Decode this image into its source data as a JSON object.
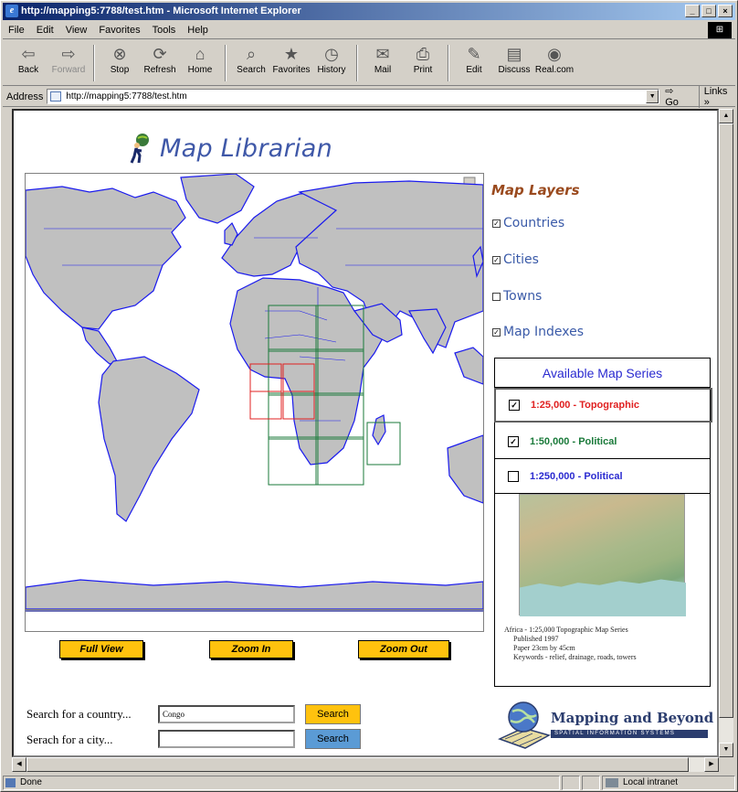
{
  "window": {
    "title": "http://mapping5:7788/test.htm - Microsoft Internet Explorer",
    "controls": [
      "_",
      "□",
      "×"
    ]
  },
  "menu": [
    "File",
    "Edit",
    "View",
    "Favorites",
    "Tools",
    "Help"
  ],
  "toolbar": [
    {
      "label": "Back",
      "icon": "back-icon",
      "glyph": "⇦",
      "disabled": false
    },
    {
      "label": "Forward",
      "icon": "forward-icon",
      "glyph": "⇨",
      "disabled": true
    },
    {
      "label": "Stop",
      "icon": "stop-icon",
      "glyph": "⊗",
      "disabled": false
    },
    {
      "label": "Refresh",
      "icon": "refresh-icon",
      "glyph": "⟳",
      "disabled": false
    },
    {
      "label": "Home",
      "icon": "home-icon",
      "glyph": "⌂",
      "disabled": false
    },
    {
      "label": "Search",
      "icon": "search-icon",
      "glyph": "⌕",
      "disabled": false
    },
    {
      "label": "Favorites",
      "icon": "favorites-icon",
      "glyph": "★",
      "disabled": false
    },
    {
      "label": "History",
      "icon": "history-icon",
      "glyph": "◷",
      "disabled": false
    },
    {
      "label": "Mail",
      "icon": "mail-icon",
      "glyph": "✉",
      "disabled": false
    },
    {
      "label": "Print",
      "icon": "print-icon",
      "glyph": "⎙",
      "disabled": false
    },
    {
      "label": "Edit",
      "icon": "edit-icon",
      "glyph": "✎",
      "disabled": false
    },
    {
      "label": "Discuss",
      "icon": "discuss-icon",
      "glyph": "▤",
      "disabled": false
    },
    {
      "label": "Real.com",
      "icon": "realcom-icon",
      "glyph": "◉",
      "disabled": false
    }
  ],
  "address": {
    "label": "Address",
    "value": "http://mapping5:7788/test.htm",
    "go": "Go",
    "links": "Links »"
  },
  "page": {
    "app_title": "Map Librarian",
    "map_buttons": {
      "full": "Full View",
      "zoom_in": "Zoom In",
      "zoom_out": "Zoom Out"
    },
    "layers": {
      "title": "Map Layers",
      "items": [
        {
          "label": "Countries",
          "checked": true
        },
        {
          "label": "Cities",
          "checked": true
        },
        {
          "label": "Towns",
          "checked": false
        },
        {
          "label": "Map Indexes",
          "checked": true
        }
      ]
    },
    "series": {
      "title": "Available Map Series",
      "items": [
        {
          "label": "1:25,000 - Topographic",
          "color": "#e02020",
          "checked": true,
          "selected": true
        },
        {
          "label": "1:50,000 - Political",
          "color": "#1a7a3a",
          "checked": true,
          "selected": false
        },
        {
          "label": "1:250,000 - Political",
          "color": "#2a2ad0",
          "checked": false,
          "selected": false
        }
      ],
      "meta": [
        "Africa - 1:25,000 Topographic Map Series",
        "Published 1997",
        "Paper 23cm by 45cm",
        "Keywords - relief, drainage, roads, towers"
      ]
    },
    "search": {
      "country_label": "Search for a country...",
      "country_value": "Congo",
      "city_label": "Serach for a city...",
      "city_value": "",
      "button": "Search",
      "button_color_1": "#ffc20e",
      "button_color_2": "#5b9bd5"
    },
    "brand": {
      "name": "Mapping and Beyond",
      "tagline": "SPATIAL INFORMATION SYSTEMS"
    }
  },
  "status": {
    "text": "Done",
    "zone": "Local intranet"
  }
}
